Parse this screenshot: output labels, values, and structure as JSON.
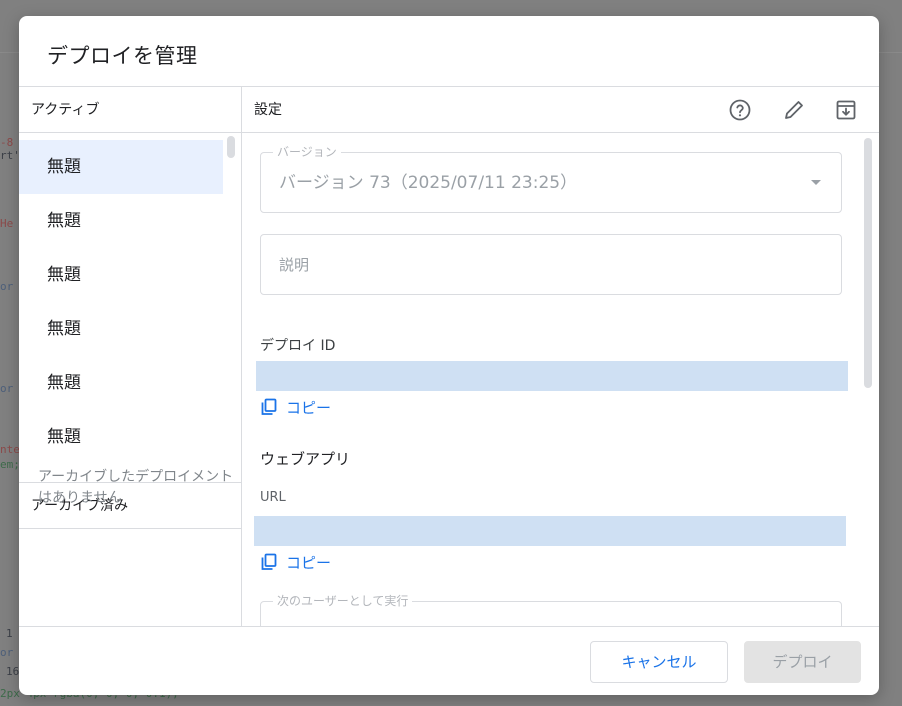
{
  "background": {
    "code_lines": [
      {
        "text": "-8",
        "color": "red"
      },
      {
        "text": "rt'",
        "color": "dark"
      },
      {
        "text": "He",
        "color": "red"
      },
      {
        "text": "or",
        "color": "blue"
      },
      {
        "text": "or",
        "color": "blue"
      },
      {
        "text": "nte",
        "color": "red"
      },
      {
        "text": "em;",
        "color": "green"
      },
      {
        "text": "1",
        "color": "dark"
      },
      {
        "text": "or",
        "color": "blue"
      },
      {
        "text": "16",
        "color": "dark"
      },
      {
        "text": "2px 4px rgba(0, 0, 0, 0.1);",
        "color": "green"
      }
    ]
  },
  "dialog": {
    "title": "デプロイを管理",
    "left": {
      "active_header": "アクティブ",
      "deployments": [
        {
          "label": "無題",
          "selected": true
        },
        {
          "label": "無題",
          "selected": false
        },
        {
          "label": "無題",
          "selected": false
        },
        {
          "label": "無題",
          "selected": false
        },
        {
          "label": "無題",
          "selected": false
        },
        {
          "label": "無題",
          "selected": false
        }
      ],
      "archived_header": "アーカイブ済み",
      "archived_empty": "アーカイブしたデプロイメントはありません"
    },
    "right": {
      "header": "設定",
      "icons": [
        "help-icon",
        "edit-icon",
        "archive-icon"
      ],
      "version_label": "バージョン",
      "version_value": "バージョン 73（2025/07/11 23:25）",
      "description_placeholder": "説明",
      "deploy_id_label": "デプロイ ID",
      "copy_label": "コピー",
      "webapp_label": "ウェブアプリ",
      "url_label": "URL",
      "execute_as_label": "次のユーザーとして実行"
    },
    "footer": {
      "cancel_label": "キャンセル",
      "deploy_label": "デプロイ"
    },
    "colors": {
      "accent": "#1a73e8",
      "selected_bg": "#e8f0fe",
      "highlight": "#cfe0f3",
      "overlay": "#7d7d7d"
    }
  }
}
